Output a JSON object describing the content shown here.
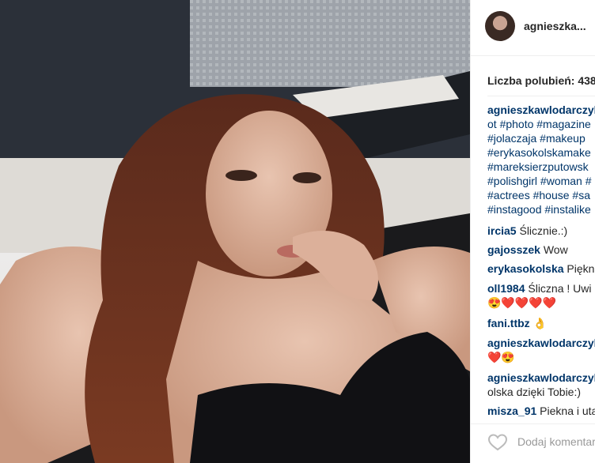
{
  "post": {
    "username": "agnieszka...",
    "likes_text": "Liczba polubień: 438",
    "caption": {
      "author": "agnieszkawlodarczyk",
      "lines": [
        "ot #photo #magazine",
        "#jolaczaja #makeup",
        "#erykasokolskamake",
        "#mareksierzputowsk",
        "#polishgirl #woman #",
        "#actrees #house #sa",
        "#instagood #instalike"
      ]
    },
    "comments": [
      {
        "user": "ircia5",
        "text": "Ślicznie.:)"
      },
      {
        "user": "gajosszek",
        "text": "Wow"
      },
      {
        "user": "erykasokolska",
        "text": "Piękn"
      },
      {
        "user": "oll1984",
        "text": "Śliczna ! Uwi",
        "line2": "😍❤️❤️❤️❤️"
      },
      {
        "user": "fani.ttbz",
        "text": "👌"
      },
      {
        "user": "agnieszkawlodarczyk",
        "text": "",
        "line2": "❤️😍"
      },
      {
        "user": "agnieszkawlodarczyk",
        "text": "",
        "line2": "olska dzięki Tobie:)"
      },
      {
        "user": "misza_91",
        "text": "Piekna i uta"
      }
    ],
    "add_comment_placeholder": "Dodaj komentarz...",
    "icons": {
      "like": "heart-outline-icon",
      "avatar": "profile-avatar"
    }
  }
}
